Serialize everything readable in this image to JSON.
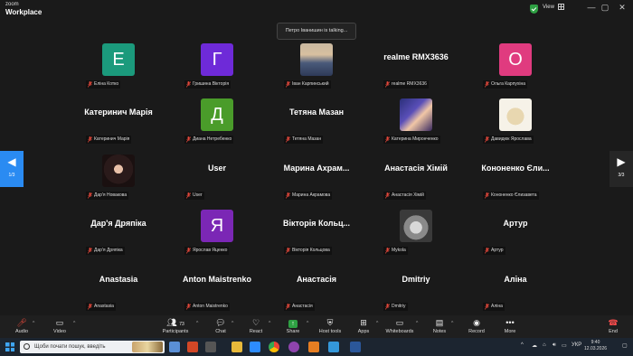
{
  "window": {
    "brand_small": "zoom",
    "brand_large": "Workplace",
    "view_label": "View",
    "controls": [
      "—",
      "▢",
      "✕"
    ]
  },
  "meeting": {
    "talking_notice": "Петро Іванишин is talking...",
    "page_left": "1/3",
    "page_right": "3/3",
    "tiles": [
      {
        "label": "Еліна Котко",
        "letter": "Е",
        "color": "#1b9a7c"
      },
      {
        "label": "Гришина Вікторія",
        "letter": "Г",
        "color": "#6e2ad8"
      },
      {
        "label": "Іван Карпинський",
        "photo": "man-photo"
      },
      {
        "label": "realme RMX3636",
        "display_name": "realme RMX3636"
      },
      {
        "label": "Ольга Карпухіна",
        "letter": "О",
        "color": "#e03b7f"
      },
      {
        "label": "Катеринич Марія",
        "display_name": "Катеринич Марія"
      },
      {
        "label": "Диана Нетребенко",
        "letter": "Д",
        "color": "#4a9c2a"
      },
      {
        "label": "Тетяна Мазан",
        "display_name": "Тетяна Мазан"
      },
      {
        "label": "Катерина Миронченко",
        "photo": "anime-photo"
      },
      {
        "label": "Давидюк Ярослава",
        "photo": "hamster-photo"
      },
      {
        "label": "Дар'я Новакова",
        "photo": "woman-photo"
      },
      {
        "label": "User",
        "display_name": "User"
      },
      {
        "label": "Марина Акрамова",
        "display_name": "Марина  Ахрам..."
      },
      {
        "label": "Анастасія Хімій",
        "display_name": "Анастасія Хімій"
      },
      {
        "label": "Кононенко Єлизавета",
        "display_name": "Кононенко Єли..."
      },
      {
        "label": "Дар'я Дряпіка",
        "display_name": "Дар'я Дряпіка"
      },
      {
        "label": "Ярослав Яценко",
        "letter": "Я",
        "color": "#7b27b5"
      },
      {
        "label": "Вікторія Кольцова",
        "display_name": "Вікторія  Кольц..."
      },
      {
        "label": "Mykola",
        "photo": "cat-photo"
      },
      {
        "label": "Артур",
        "display_name": "Артур"
      },
      {
        "label": "Anastasia",
        "display_name": "Anastasia"
      },
      {
        "label": "Anton Maistrenko",
        "display_name": "Anton Maistrenko"
      },
      {
        "label": "Анастасія",
        "display_name": "Анастасія"
      },
      {
        "label": "Dmitriy",
        "display_name": "Dmitriy"
      },
      {
        "label": "Аліна",
        "display_name": "Аліна"
      }
    ]
  },
  "toolbar": {
    "audio": "Audio",
    "video": "Video",
    "participants": "Participants",
    "participants_count": "73",
    "chat": "Chat",
    "react": "React",
    "share": "Share",
    "host_tools": "Host tools",
    "apps": "Apps",
    "whiteboards": "Whiteboards",
    "notes": "Notes",
    "record": "Record",
    "more": "More",
    "end": "End"
  },
  "taskbar": {
    "search_placeholder": "Щоби почати пошук, введіть",
    "language": "УКР",
    "time": "9:40",
    "date": "12.03.2026"
  },
  "colors": {
    "accent_blue": "#2a8bf2",
    "muted_red": "#e0473a",
    "end_red": "#ff4d4d"
  }
}
